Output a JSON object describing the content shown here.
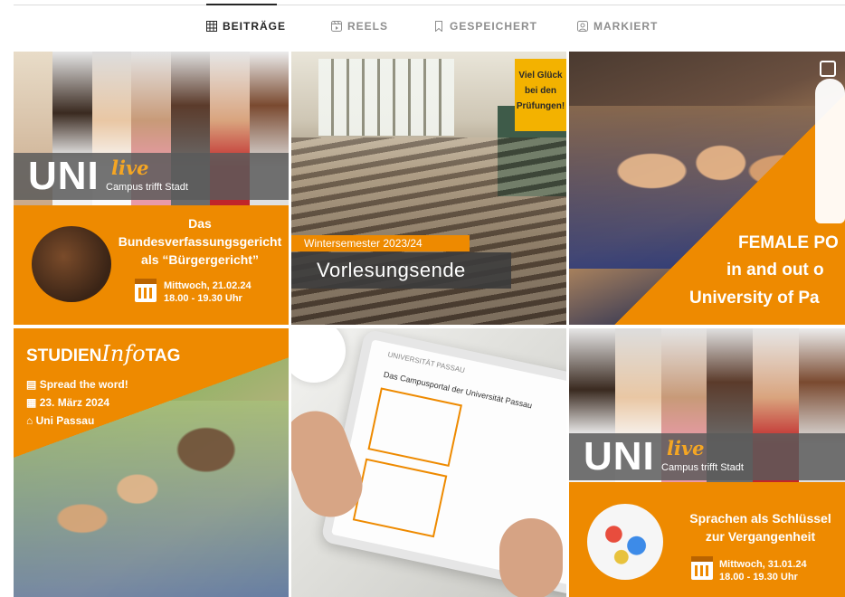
{
  "tabs": [
    {
      "label": "BEITRÄGE",
      "icon": "grid-icon",
      "active": true
    },
    {
      "label": "REELS",
      "icon": "reels-icon",
      "active": false
    },
    {
      "label": "GESPEICHERT",
      "icon": "bookmark-icon",
      "active": false
    },
    {
      "label": "MARKIERT",
      "icon": "tagged-icon",
      "active": false
    }
  ],
  "posts": {
    "p1": {
      "logo": "UNI",
      "live": "live",
      "subtitle": "Campus trifft Stadt",
      "title_l1": "Das",
      "title_l2": "Bundesverfassungsgericht",
      "title_l3": "als “Bürgergericht”",
      "date": "Mittwoch, 21.02.24",
      "time": "18.00 - 19.30 Uhr"
    },
    "p2": {
      "sign_l1": "Viel Glück",
      "sign_l2": "bei den",
      "sign_l3": "Prüfungen!",
      "semester": "Wintersemester 2023/24",
      "event": "Vorlesungsende"
    },
    "p3": {
      "l1": "FEMALE PO",
      "l2": "in and out o",
      "l3": "University of Pa"
    },
    "p4": {
      "title_a": "STUDIEN",
      "title_b": "Info",
      "title_c": "TAG",
      "item1": "Spread the word!",
      "item2": "23. März 2024",
      "item3": "Uni Passau"
    },
    "p5": {
      "portal_title": "Das Campusportal der Universität Passau",
      "uni": "UNIVERSITÄT PASSAU"
    },
    "p6": {
      "logo": "UNI",
      "live": "live",
      "subtitle": "Campus trifft Stadt",
      "title_l1": "Sprachen als Schlüssel",
      "title_l2": "zur Vergangenheit",
      "date": "Mittwoch, 31.01.24",
      "time": "18.00 - 19.30 Uhr"
    }
  }
}
